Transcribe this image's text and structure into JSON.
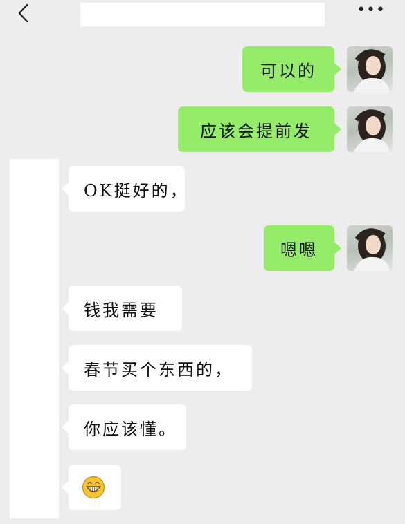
{
  "header": {
    "title": "",
    "more_label": "•••"
  },
  "messages": [
    {
      "side": "sent",
      "text": "可以的"
    },
    {
      "side": "sent",
      "text": "应该会提前发"
    },
    {
      "side": "received",
      "text": "OK挺好的，"
    },
    {
      "side": "sent",
      "text": "嗯嗯"
    },
    {
      "side": "received",
      "text": "钱我需要"
    },
    {
      "side": "received",
      "text": "春节买个东西的，"
    },
    {
      "side": "received",
      "text": "你应该懂。"
    },
    {
      "side": "received",
      "emoji": "grinning-face-emoji"
    }
  ],
  "colors": {
    "background": "#ededed",
    "sent_bubble": "#95ec69",
    "received_bubble": "#ffffff"
  }
}
